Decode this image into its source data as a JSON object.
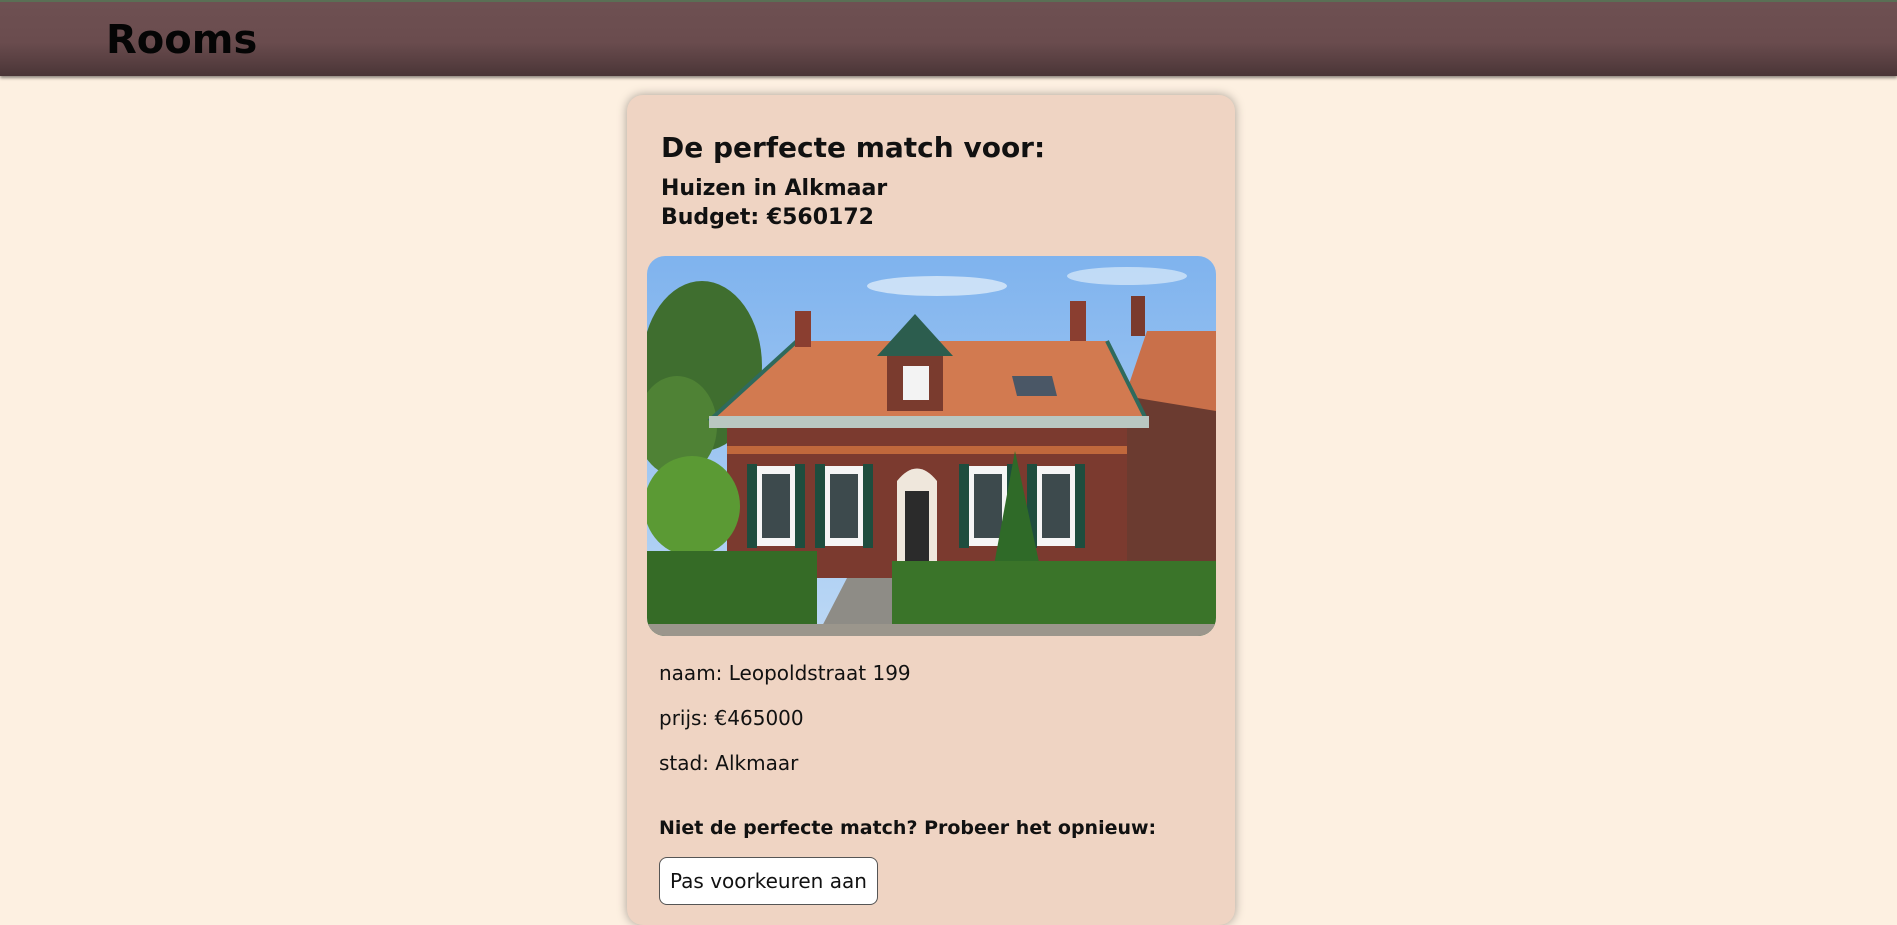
{
  "header": {
    "brand": "Rooms"
  },
  "match": {
    "title": "De perfecte match voor:",
    "city_line": "Huizen in Alkmaar",
    "budget_line": "Budget: €560172",
    "photo_icon": "house-photo",
    "fields": {
      "name": "naam: Leopoldstraat 199",
      "price": "prijs: €465000",
      "city": "stad: Alkmaar"
    },
    "retry_label": "Niet de perfecte match? Probeer het opnieuw:",
    "preferences_button": "Pas voorkeuren aan"
  },
  "colors": {
    "page_background": "#fdf0e1",
    "header_background": "#6a4c4e",
    "card_background": "#efd4c3"
  }
}
